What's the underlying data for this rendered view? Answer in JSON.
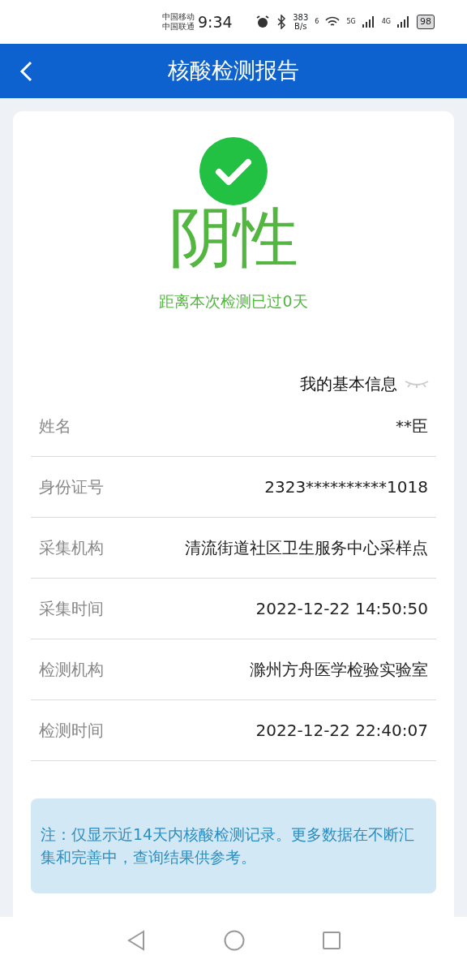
{
  "status_bar": {
    "carriers": [
      "中国移动",
      "中国联通"
    ],
    "time": "9:34",
    "speed": "383",
    "speed_unit": "B/s",
    "wifi_label": "6",
    "sim1_label": "5G",
    "sim2_label": "4G",
    "battery": "98"
  },
  "header": {
    "title": "核酸检测报告"
  },
  "result": {
    "text": "阴性",
    "days": "距离本次检测已过0天"
  },
  "info": {
    "title": "我的基本信息",
    "rows": [
      {
        "label": "姓名",
        "value": "**臣"
      },
      {
        "label": "身份证号",
        "value": "2323**********1018"
      },
      {
        "label": "采集机构",
        "value": "清流街道社区卫生服务中心采样点"
      },
      {
        "label": "采集时间",
        "value": "2022-12-22 14:50:50"
      },
      {
        "label": "检测机构",
        "value": "滁州方舟医学检验实验室"
      },
      {
        "label": "检测时间",
        "value": "2022-12-22 22:40:07"
      }
    ]
  },
  "note": "注：仅显示近14天内核酸检测记录。更多数据在不断汇集和完善中，查询结果供参考。"
}
